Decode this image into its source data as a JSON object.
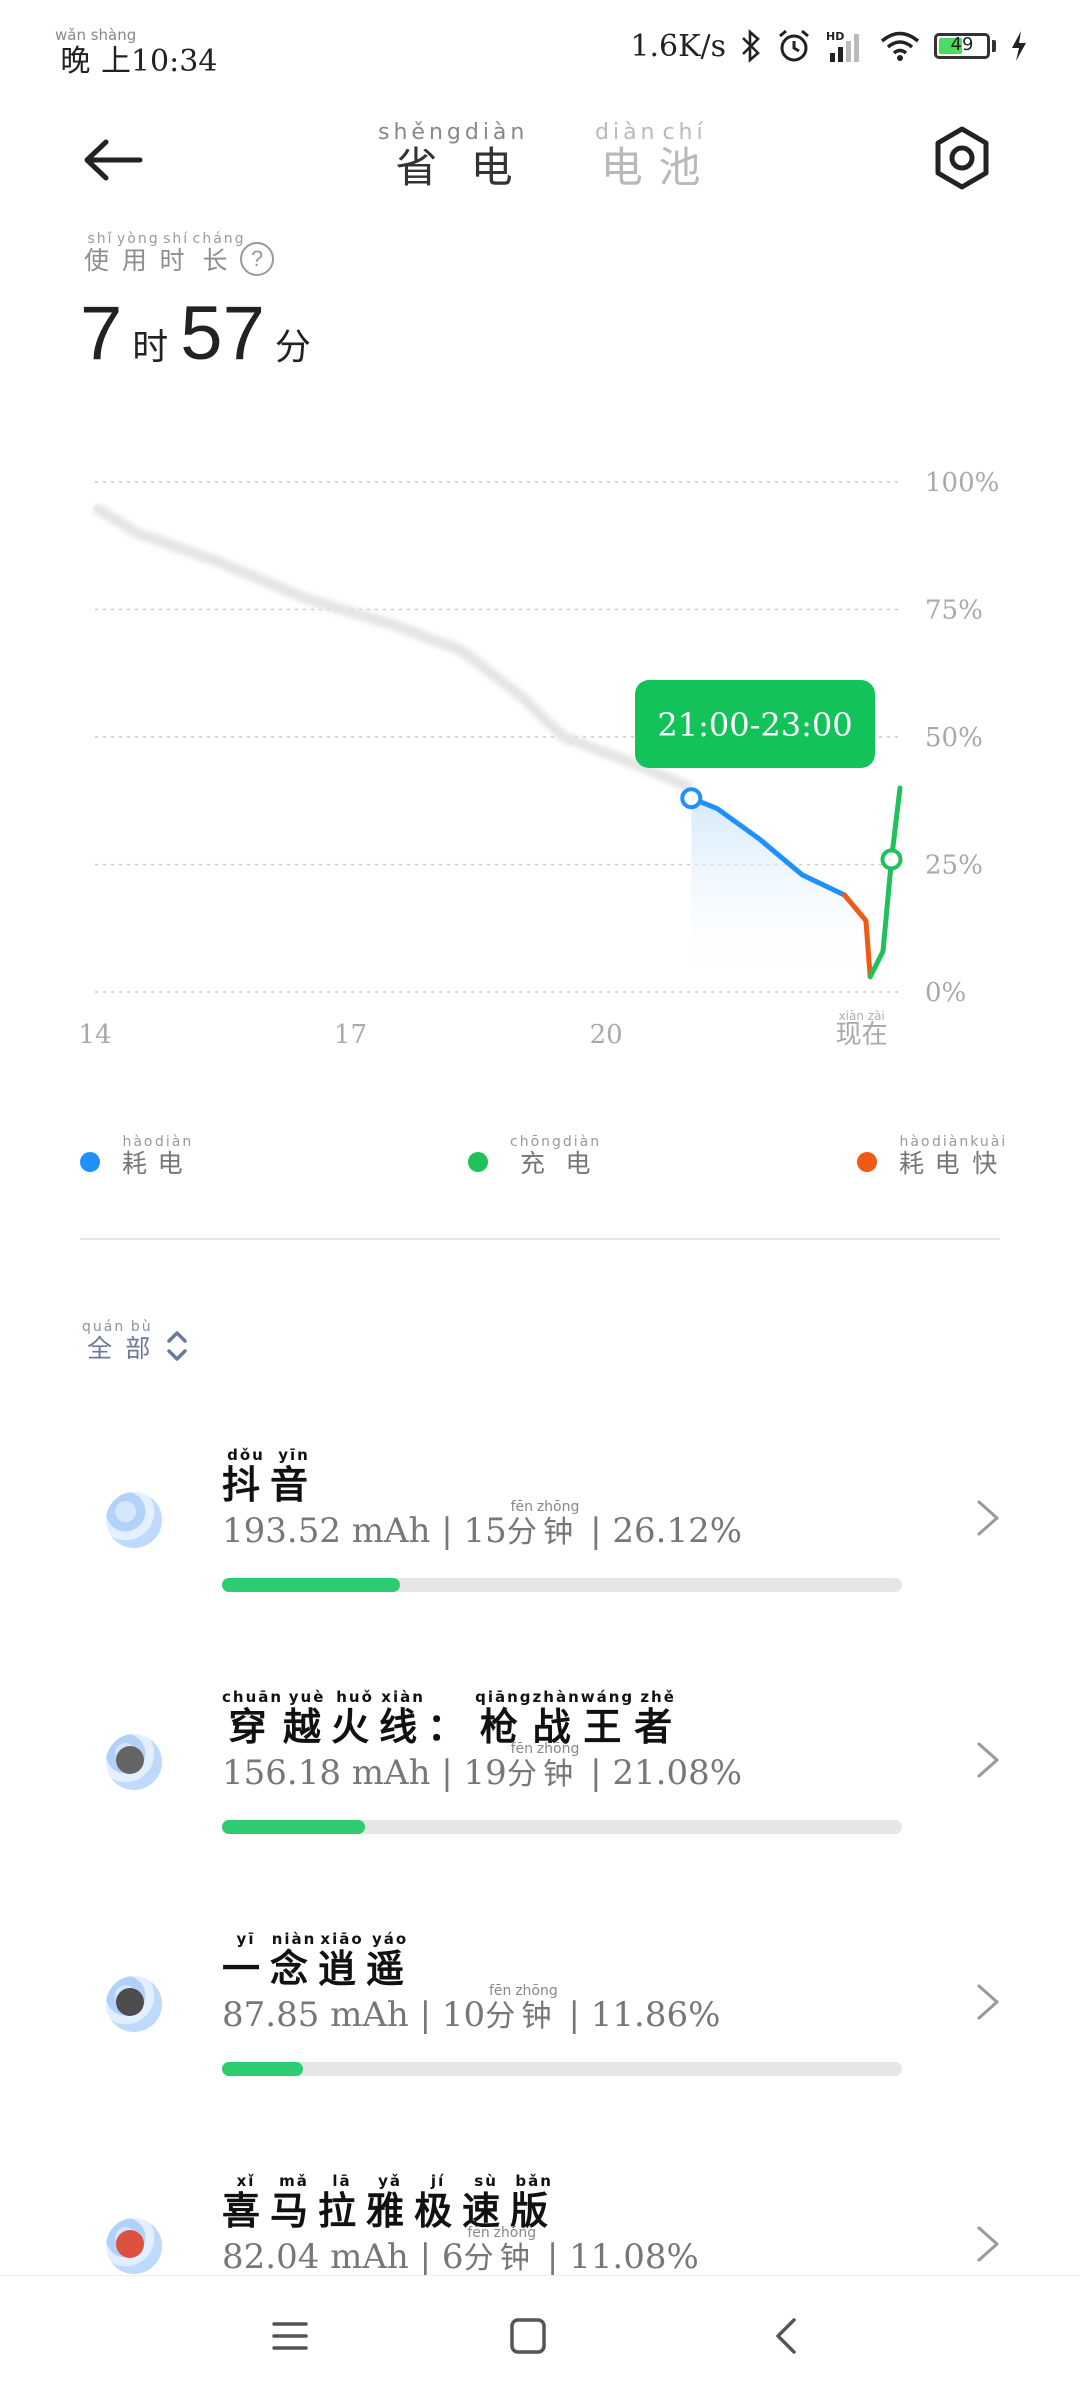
{
  "status_bar": {
    "time_ruby": "wǎn shàng",
    "time_prefix": "晚上",
    "time": "10:34",
    "network_speed": "1.6K/s",
    "battery_level": "49",
    "battery_fraction": 0.49,
    "icons": [
      "bluetooth-icon",
      "alarm-icon",
      "hd-signal-icon",
      "wifi-icon",
      "battery-icon",
      "charging-bolt-icon"
    ]
  },
  "header": {
    "tabs": [
      {
        "label": "省电",
        "ruby": [
          "shěng",
          "diàn"
        ],
        "chars": [
          "省",
          "电"
        ],
        "active": true
      },
      {
        "label": "电池",
        "ruby": [
          "diàn",
          "chí"
        ],
        "chars": [
          "电",
          "池"
        ],
        "active": false
      }
    ],
    "back_icon": "arrow-left-icon",
    "settings_icon": "hexagon-settings-icon"
  },
  "usage": {
    "label": "使用时长",
    "label_chars": [
      "使",
      "用",
      "时",
      "长"
    ],
    "label_ruby": [
      "shǐ",
      "yòng",
      "shí",
      "cháng"
    ],
    "hours": "7",
    "hours_unit": "时",
    "minutes": "57",
    "minutes_unit": "分"
  },
  "chart_data": {
    "type": "line",
    "y_ticks": [
      "100%",
      "75%",
      "50%",
      "25%",
      "0%"
    ],
    "x_ticks": [
      "14",
      "17",
      "20",
      "现在"
    ],
    "x_tick_ruby_now": "xiàn zài",
    "ylim": [
      0,
      100
    ],
    "tooltip": "21:00-23:00",
    "colors": {
      "normal": "#1e90ff",
      "charging": "#20c15a",
      "fast_drain": "#f05a14",
      "history": "#e0e0e0",
      "tooltip_bg": "#14c25a"
    },
    "series": [
      {
        "name": "history",
        "points": [
          [
            14.0,
            95
          ],
          [
            14.5,
            90
          ],
          [
            15.5,
            84
          ],
          [
            16.5,
            77
          ],
          [
            17.5,
            72
          ],
          [
            18.3,
            67
          ],
          [
            19.0,
            58
          ],
          [
            19.5,
            50
          ],
          [
            20.3,
            45
          ],
          [
            21.0,
            40
          ]
        ]
      },
      {
        "name": "耗电",
        "points": [
          [
            21.0,
            38
          ],
          [
            21.3,
            36
          ],
          [
            21.8,
            30
          ],
          [
            22.3,
            23
          ],
          [
            22.8,
            19
          ]
        ]
      },
      {
        "name": "耗电快",
        "points": [
          [
            22.8,
            19
          ],
          [
            23.05,
            14
          ],
          [
            23.1,
            3
          ]
        ]
      },
      {
        "name": "充电",
        "points": [
          [
            23.1,
            3
          ],
          [
            23.25,
            8
          ],
          [
            23.35,
            26
          ],
          [
            23.45,
            40
          ]
        ]
      }
    ],
    "markers": [
      [
        21.0,
        38
      ],
      [
        23.35,
        26
      ]
    ]
  },
  "legend": [
    {
      "label": "耗电",
      "chars": [
        "耗",
        "电"
      ],
      "ruby": [
        "hào",
        "diàn"
      ],
      "color": "#1e90ff"
    },
    {
      "label": "充电",
      "chars": [
        "充",
        "电"
      ],
      "ruby": [
        "chōng",
        "diàn"
      ],
      "color": "#20c15a"
    },
    {
      "label": "耗电快",
      "chars": [
        "耗",
        "电",
        "快"
      ],
      "ruby": [
        "hào",
        "diàn",
        "kuài"
      ],
      "color": "#f05a14"
    }
  ],
  "filter": {
    "label": "全部",
    "chars": [
      "全",
      "部"
    ],
    "ruby": [
      "quán",
      "bù"
    ]
  },
  "apps": [
    {
      "name": "抖音",
      "chars": [
        "抖",
        "音"
      ],
      "ruby": [
        "dǒu",
        "yīn"
      ],
      "mah": "193.52 mAh",
      "minutes": "15",
      "percent": "26.12%",
      "fraction": 0.2612
    },
    {
      "name": "穿越火线：枪战王者",
      "chars": [
        "穿",
        "越",
        "火",
        "线",
        "：",
        "枪",
        "战",
        "王",
        "者"
      ],
      "ruby": [
        "chuān",
        "yuè",
        "huǒ",
        "xiàn",
        "",
        "qiāng",
        "zhàn",
        "wáng",
        "zhě"
      ],
      "mah": "156.18 mAh",
      "minutes": "19",
      "percent": "21.08%",
      "fraction": 0.2108
    },
    {
      "name": "一念逍遥",
      "chars": [
        "一",
        "念",
        "逍",
        "遥"
      ],
      "ruby": [
        "yī",
        "niàn",
        "xiāo",
        "yáo"
      ],
      "mah": "87.85 mAh",
      "minutes": "10",
      "percent": "11.86%",
      "fraction": 0.1186
    },
    {
      "name": "喜马拉雅极速版",
      "chars": [
        "喜",
        "马",
        "拉",
        "雅",
        "极",
        "速",
        "版"
      ],
      "ruby": [
        "xǐ",
        "mǎ",
        "lā",
        "yǎ",
        "jí",
        "sù",
        "bǎn"
      ],
      "mah": "82.04 mAh",
      "minutes": "6",
      "percent": "11.08%",
      "fraction": 0.1108
    }
  ],
  "minute_unit": {
    "chars": [
      "分",
      "钟"
    ],
    "ruby": [
      "fēn",
      "zhōng"
    ]
  },
  "nav": {
    "icons": [
      "menu-icon",
      "home-square-icon",
      "back-chevron-icon"
    ]
  }
}
